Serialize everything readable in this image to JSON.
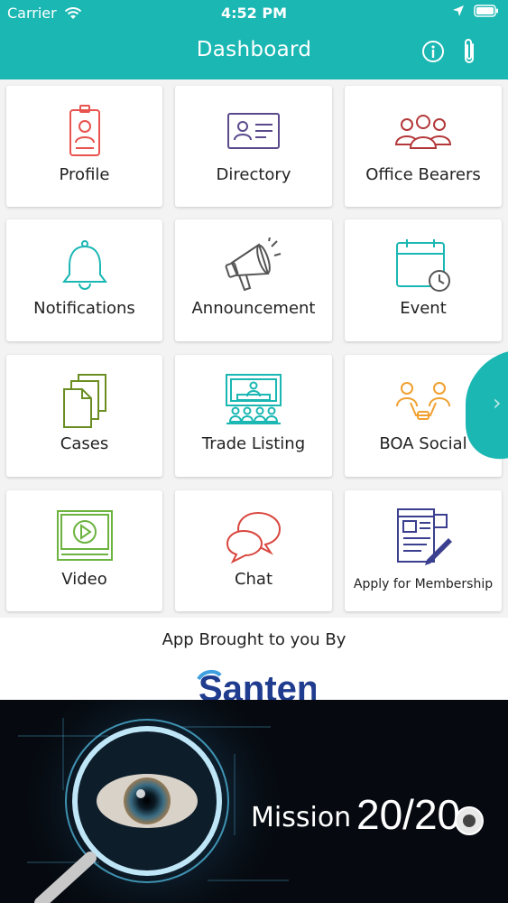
{
  "status": {
    "carrier": "Carrier",
    "time": "4:52 PM"
  },
  "header": {
    "title": "Dashboard"
  },
  "tiles": [
    {
      "label": "Profile",
      "icon": "id-badge-icon"
    },
    {
      "label": "Directory",
      "icon": "contact-card-icon"
    },
    {
      "label": "Office Bearers",
      "icon": "group-icon"
    },
    {
      "label": "Notifications",
      "icon": "bell-icon"
    },
    {
      "label": "Announcement",
      "icon": "megaphone-icon"
    },
    {
      "label": "Event",
      "icon": "calendar-clock-icon"
    },
    {
      "label": "Cases",
      "icon": "documents-icon"
    },
    {
      "label": "Trade Listing",
      "icon": "presentation-icon"
    },
    {
      "label": "BOA Social",
      "icon": "social-network-icon"
    },
    {
      "label": "Video",
      "icon": "video-player-icon"
    },
    {
      "label": "Chat",
      "icon": "chat-bubbles-icon"
    },
    {
      "label": "Apply for Membership",
      "icon": "application-form-icon"
    }
  ],
  "sponsor": {
    "brought_by": "App Brought to you By",
    "logo_text": "Santen"
  },
  "banner": {
    "mission_text": "Mission",
    "mission_number": "20/20"
  },
  "colors": {
    "accent": "#1ab7b3",
    "profile": "#e8534f",
    "directory": "#5a4a8c",
    "bearers": "#b3383a",
    "notifications": "#1ab7b3",
    "announcement": "#555555",
    "event": "#1ab7b3",
    "cases": "#6b8e23",
    "trade": "#1ab7b3",
    "social": "#f0a030",
    "video": "#6cb33f",
    "chat": "#d9473f",
    "membership": "#3a3f8f"
  }
}
